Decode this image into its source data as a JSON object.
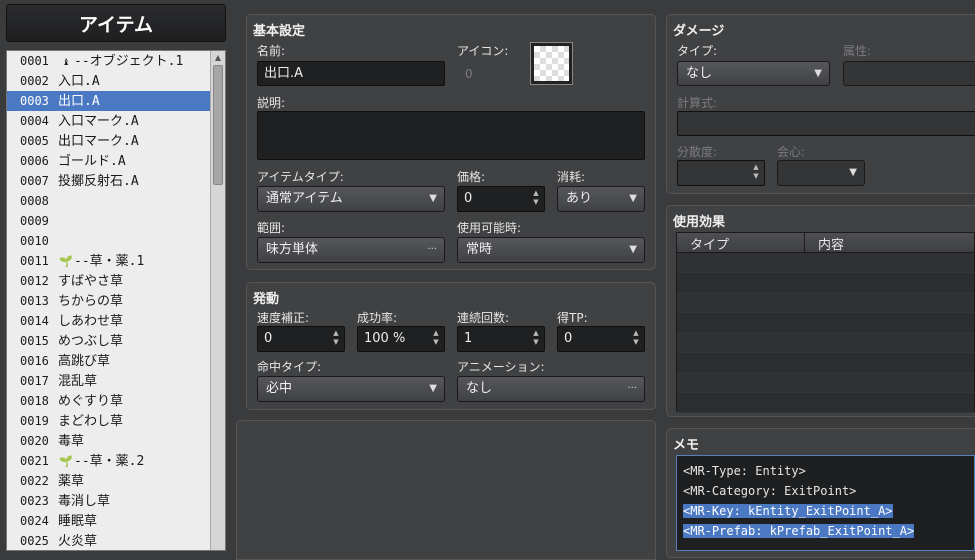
{
  "header": {
    "title": "アイテム"
  },
  "items": [
    {
      "num": "0001",
      "icon": "♝",
      "label": "--オブジェクト.1"
    },
    {
      "num": "0002",
      "icon": "",
      "label": "入口.A"
    },
    {
      "num": "0003",
      "icon": "",
      "label": "出口.A",
      "selected": true
    },
    {
      "num": "0004",
      "icon": "",
      "label": "入口マーク.A"
    },
    {
      "num": "0005",
      "icon": "",
      "label": "出口マーク.A"
    },
    {
      "num": "0006",
      "icon": "",
      "label": "ゴールド.A"
    },
    {
      "num": "0007",
      "icon": "",
      "label": "投擲反射石.A"
    },
    {
      "num": "0008",
      "icon": "",
      "label": ""
    },
    {
      "num": "0009",
      "icon": "",
      "label": ""
    },
    {
      "num": "0010",
      "icon": "",
      "label": ""
    },
    {
      "num": "0011",
      "icon": "🌱",
      "label": "--草・薬.1"
    },
    {
      "num": "0012",
      "icon": "",
      "label": "すばやさ草"
    },
    {
      "num": "0013",
      "icon": "",
      "label": "ちからの草"
    },
    {
      "num": "0014",
      "icon": "",
      "label": "しあわせ草"
    },
    {
      "num": "0015",
      "icon": "",
      "label": "めつぶし草"
    },
    {
      "num": "0016",
      "icon": "",
      "label": "高跳び草"
    },
    {
      "num": "0017",
      "icon": "",
      "label": "混乱草"
    },
    {
      "num": "0018",
      "icon": "",
      "label": "めぐすり草"
    },
    {
      "num": "0019",
      "icon": "",
      "label": "まどわし草"
    },
    {
      "num": "0020",
      "icon": "",
      "label": "毒草"
    },
    {
      "num": "0021",
      "icon": "🌱",
      "label": "--草・薬.2"
    },
    {
      "num": "0022",
      "icon": "",
      "label": "薬草"
    },
    {
      "num": "0023",
      "icon": "",
      "label": "毒消し草"
    },
    {
      "num": "0024",
      "icon": "",
      "label": "睡眠草"
    },
    {
      "num": "0025",
      "icon": "",
      "label": "火炎草"
    }
  ],
  "basic": {
    "title": "基本設定",
    "name_label": "名前:",
    "name_value": "出口.A",
    "icon_label": "アイコン:",
    "icon_index": "0",
    "desc_label": "説明:",
    "itemtype_label": "アイテムタイプ:",
    "itemtype_value": "通常アイテム",
    "price_label": "価格:",
    "price_value": "0",
    "consume_label": "消耗:",
    "consume_value": "あり",
    "scope_label": "範囲:",
    "scope_value": "味方単体",
    "occasion_label": "使用可能時:",
    "occasion_value": "常時"
  },
  "invocation": {
    "title": "発動",
    "speed_label": "速度補正:",
    "speed_value": "0",
    "success_label": "成功率:",
    "success_value": "100 %",
    "repeat_label": "連続回数:",
    "repeat_value": "1",
    "tp_label": "得TP:",
    "tp_value": "0",
    "hittype_label": "命中タイプ:",
    "hittype_value": "必中",
    "anim_label": "アニメーション:",
    "anim_value": "なし"
  },
  "damage": {
    "title": "ダメージ",
    "type_label": "タイプ:",
    "type_value": "なし",
    "element_label": "属性:",
    "formula_label": "計算式:",
    "variance_label": "分散度:",
    "critical_label": "会心:"
  },
  "effects": {
    "title": "使用効果",
    "col_type": "タイプ",
    "col_content": "内容"
  },
  "memo": {
    "title": "メモ",
    "lines": [
      "<MR-Type: Entity>",
      "<MR-Category: ExitPoint>",
      "<MR-Key: kEntity_ExitPoint_A>",
      "<MR-Prefab: kPrefab_ExitPoint_A>"
    ]
  },
  "glyphs": {
    "ellipsis": "···",
    "arrow_down": "▼",
    "arrow_up": "▲"
  }
}
